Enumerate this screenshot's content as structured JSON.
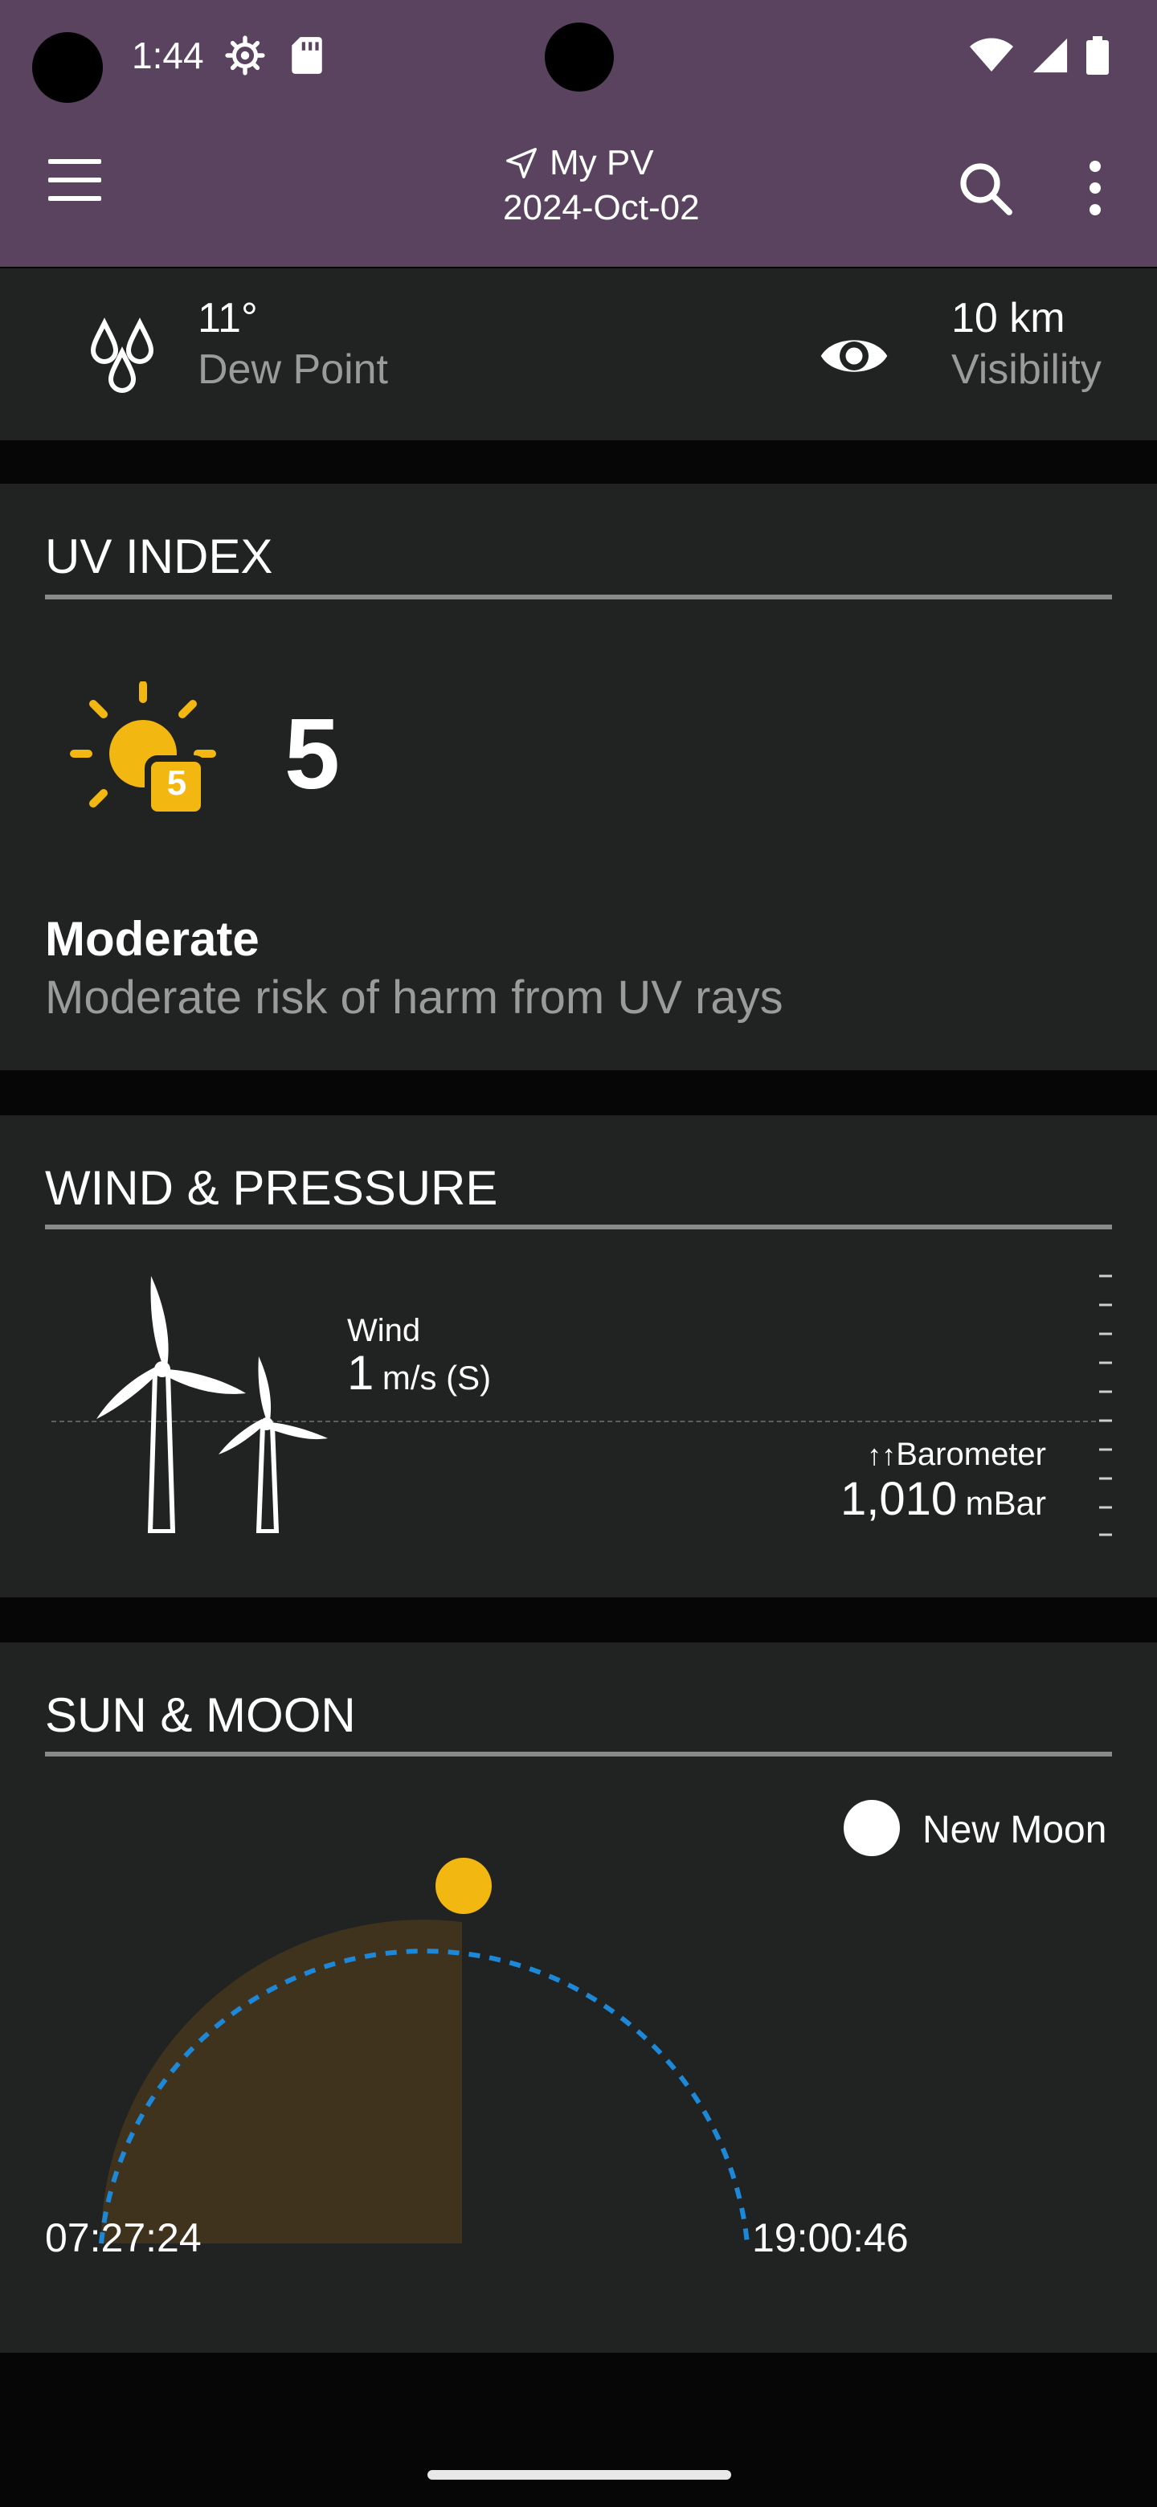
{
  "status": {
    "time": "1:44"
  },
  "toolbar": {
    "location": "My PV",
    "date": "2024-Oct-02"
  },
  "conditions": {
    "dew_point": {
      "value": "11°",
      "label": "Dew Point",
      "icon": "droplets-icon"
    },
    "visibility": {
      "value": "10 km",
      "label": "Visibility",
      "icon": "eye-icon"
    }
  },
  "uv": {
    "title": "UV INDEX",
    "value": "5",
    "badge": "5",
    "level": "Moderate",
    "description": "Moderate risk of harm from UV rays"
  },
  "wind": {
    "title": "WIND & PRESSURE",
    "wind_label": "Wind",
    "wind_value": "1",
    "wind_unit": "m/s (S)",
    "barometer_arrows": "↑↑",
    "barometer_label": "Barometer",
    "barometer_value": "1,010",
    "barometer_unit": "mBar"
  },
  "sun": {
    "title": "SUN & MOON",
    "moon_phase": "New Moon",
    "sunrise": "07:27:24",
    "sunset": "19:00:46"
  },
  "colors": {
    "toolbar": "#5a435e",
    "card": "#212322",
    "sun": "#f3b712",
    "arc": "#1d87d8",
    "day_fill": "#3f331d"
  }
}
